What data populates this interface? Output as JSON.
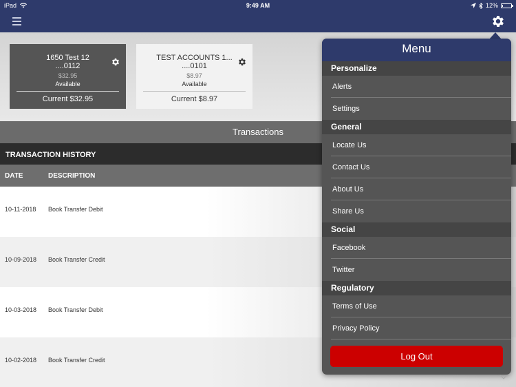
{
  "status_bar": {
    "device": "iPad",
    "time": "9:49 AM",
    "battery": "12%",
    "battery_level": 0.12
  },
  "nav": {
    "menu_icon": "hamburger-icon",
    "settings_icon": "gear-icon"
  },
  "accounts": [
    {
      "name": "1650 Test 12",
      "number": "....0112",
      "balance": "$32.95",
      "availability": "Available",
      "current": "Current $32.95",
      "selected": true
    },
    {
      "name": "TEST ACCOUNTS 1...",
      "number": "....0101",
      "balance": "$8.97",
      "availability": "Available",
      "current": "Current $8.97",
      "selected": false
    }
  ],
  "transactions": {
    "title": "Transactions",
    "history_label": "TRANSACTION HISTORY",
    "columns": {
      "date": "DATE",
      "description": "DESCRIPTION"
    },
    "rows": [
      {
        "date": "10-11-2018",
        "description": "Book Transfer Debit"
      },
      {
        "date": "10-09-2018",
        "description": "Book Transfer Credit"
      },
      {
        "date": "10-03-2018",
        "description": "Book Transfer Debit"
      },
      {
        "date": "10-02-2018",
        "description": "Book Transfer Credit"
      }
    ]
  },
  "menu": {
    "title": "Menu",
    "sections": {
      "personalize": "Personalize",
      "general": "General",
      "social": "Social",
      "regulatory": "Regulatory"
    },
    "items": {
      "alerts": "Alerts",
      "settings": "Settings",
      "locate_us": "Locate Us",
      "contact_us": "Contact Us",
      "about_us": "About Us",
      "share_us": "Share Us",
      "facebook": "Facebook",
      "twitter": "Twitter",
      "terms_of_use": "Terms of Use",
      "privacy_policy": "Privacy Policy"
    },
    "logout_label": "Log Out"
  },
  "colors": {
    "nav_bg": "#2e3a6b",
    "menu_bg": "#555555",
    "section_bg": "#454545",
    "logout_red": "#cc0000",
    "selected_card": "#555555"
  }
}
